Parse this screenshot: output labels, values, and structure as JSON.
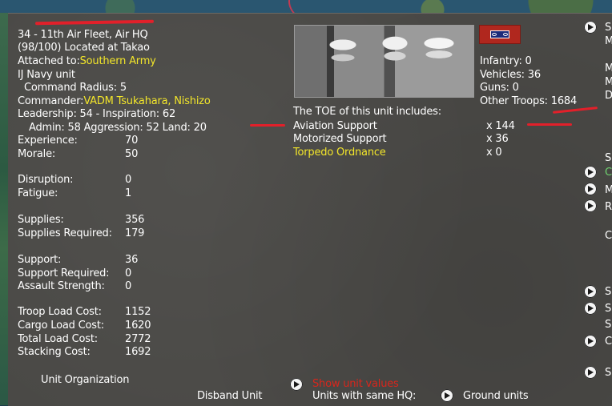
{
  "unit": {
    "title": "34 - 11th Air Fleet, Air HQ",
    "location": "(98/100) Located at Takao",
    "attached_label": "Attached to:",
    "attached_value": "Southern Army",
    "service": "IJ Navy unit",
    "command_radius": "Command Radius: 5",
    "commander_label": "Commander:",
    "commander_value": "VADM Tsukahara, Nishizo",
    "leadership": "Leadership: 54 - Inspiration: 62",
    "admin": "Admin: 58  Aggression: 52 Land: 20"
  },
  "stats": [
    {
      "label": "Experience:",
      "value": "70"
    },
    {
      "label": "Morale:",
      "value": "50"
    },
    {
      "label": "Disruption:",
      "value": "0"
    },
    {
      "label": "Fatigue:",
      "value": "1"
    },
    {
      "label": "Supplies:",
      "value": "356"
    },
    {
      "label": "Supplies Required:",
      "value": "179"
    },
    {
      "label": "Support:",
      "value": "36"
    },
    {
      "label": "Support Required:",
      "value": "0"
    },
    {
      "label": "Assault Strength:",
      "value": "0"
    },
    {
      "label": "Troop Load Cost:",
      "value": "1152"
    },
    {
      "label": "Cargo Load Cost:",
      "value": "1620"
    },
    {
      "label": "Total Load Cost:",
      "value": "2772"
    },
    {
      "label": "Stacking Cost:",
      "value": "1692"
    }
  ],
  "troops": {
    "infantry": "Infantry: 0",
    "vehicles": "Vehicles: 36",
    "guns": "Guns: 0",
    "other": "Other Troops: 1684"
  },
  "toe": {
    "header": "The TOE of this unit includes:",
    "items": [
      {
        "name": "Aviation Support",
        "qty": "x 144"
      },
      {
        "name": "Motorized Support",
        "qty": "x 36"
      },
      {
        "name": "Torpedo Ordnance",
        "qty": "x 0"
      }
    ]
  },
  "bottom": {
    "unit_org": "Unit Organization",
    "disband": "Disband Unit",
    "show_values": "Show unit values",
    "same_hq": "Units with same HQ:",
    "ground_units": "Ground units"
  },
  "right_edge": {
    "letters": [
      "S",
      "M",
      "M",
      "M",
      "D",
      "S",
      "C",
      "M",
      "R",
      "C",
      "S",
      "S",
      "S",
      "C",
      "S"
    ]
  },
  "colors": {
    "panel": "#4a4946",
    "highlight": "#f2e52a",
    "annotation": "#e2202a",
    "alert": "#d8261c"
  }
}
